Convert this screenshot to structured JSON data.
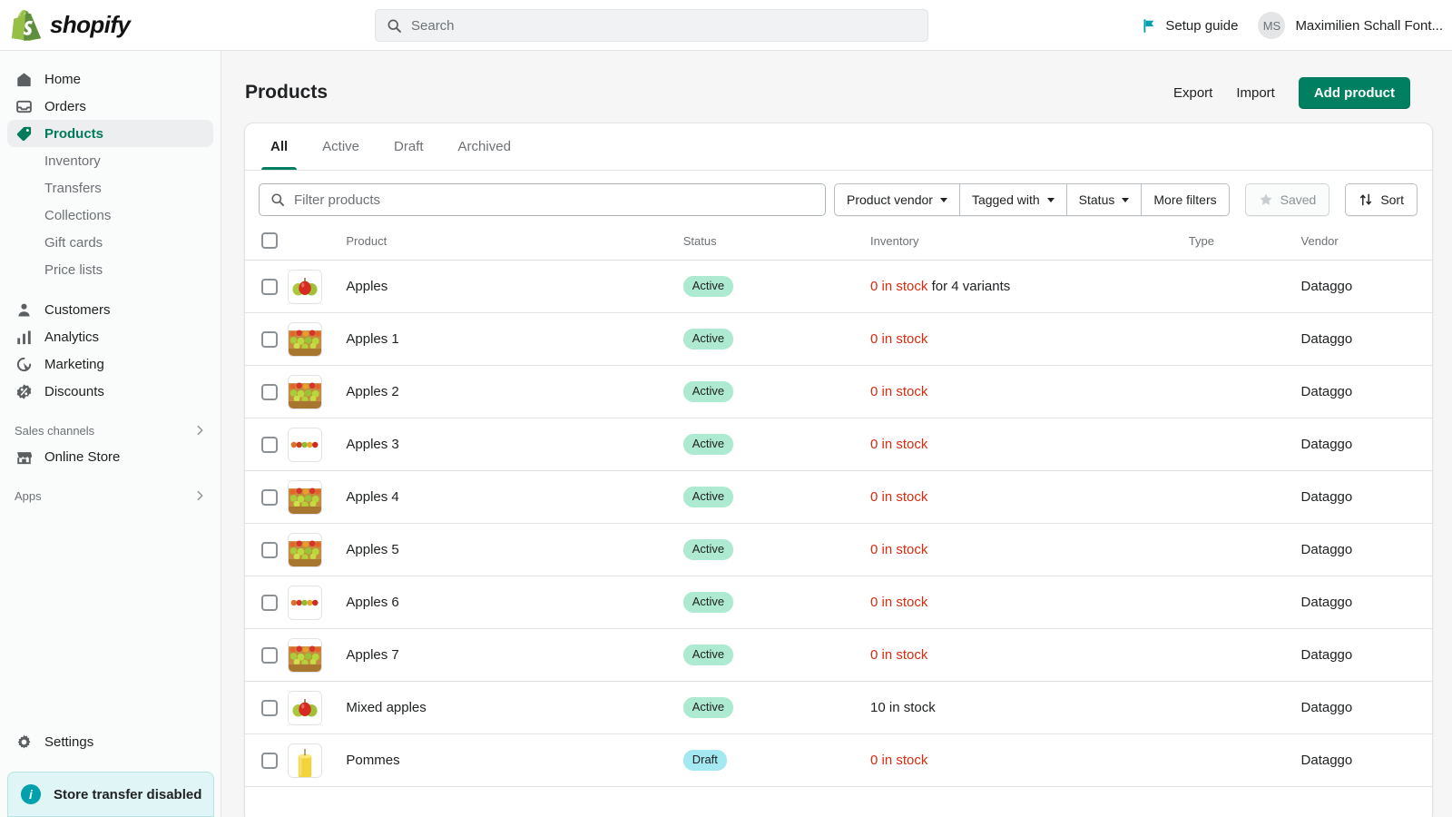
{
  "topbar": {
    "brand_name": "shopify",
    "search_placeholder": "Search",
    "search_value": "",
    "search_icon": "search-icon",
    "setup_guide_label": "Setup guide",
    "setup_guide_icon": "flag-icon",
    "user_initials": "MS",
    "user_name": "Maximilien Schall Font...",
    "accent_teal": "#00a0ac"
  },
  "sidebar": {
    "items": [
      {
        "label": "Home",
        "icon": "home-icon",
        "active": false
      },
      {
        "label": "Orders",
        "icon": "orders-inbox-icon",
        "active": false
      },
      {
        "label": "Products",
        "icon": "product-tag-icon",
        "active": true
      }
    ],
    "sub_items": [
      {
        "label": "Inventory"
      },
      {
        "label": "Transfers"
      },
      {
        "label": "Collections"
      },
      {
        "label": "Gift cards"
      },
      {
        "label": "Price lists"
      }
    ],
    "items2": [
      {
        "label": "Customers",
        "icon": "customer-icon"
      },
      {
        "label": "Analytics",
        "icon": "analytics-bars-icon"
      },
      {
        "label": "Marketing",
        "icon": "marketing-target-icon"
      },
      {
        "label": "Discounts",
        "icon": "discount-badge-icon"
      }
    ],
    "sales_channels_label": "Sales channels",
    "online_store_label": "Online Store",
    "online_store_icon": "storefront-icon",
    "apps_label": "Apps",
    "chevron_icon": "chevron-right-icon",
    "settings_label": "Settings",
    "settings_icon": "gear-icon",
    "banner": {
      "label": "Store transfer disabled",
      "icon": "info-icon",
      "bg": "#e0f5f5"
    }
  },
  "header": {
    "title": "Products",
    "export_label": "Export",
    "import_label": "Import",
    "add_product_label": "Add product",
    "primary_color": "#008060"
  },
  "tabs": [
    {
      "label": "All",
      "active": true
    },
    {
      "label": "Active",
      "active": false
    },
    {
      "label": "Draft",
      "active": false
    },
    {
      "label": "Archived",
      "active": false
    }
  ],
  "filters": {
    "search_placeholder": "Filter products",
    "search_value": "",
    "search_icon": "search-icon",
    "buttons": [
      {
        "label": "Product vendor",
        "caret": true
      },
      {
        "label": "Tagged with",
        "caret": true
      },
      {
        "label": "Status",
        "caret": true
      },
      {
        "label": "More filters",
        "caret": false
      }
    ],
    "saved_label": "Saved",
    "saved_icon": "star-icon",
    "saved_disabled": true,
    "sort_label": "Sort",
    "sort_icon": "sort-arrows-icon"
  },
  "table": {
    "columns": [
      "Product",
      "Status",
      "Inventory",
      "Type",
      "Vendor"
    ],
    "select_all_checkbox": "select-all-checkbox",
    "rows": [
      {
        "name": "Apples",
        "thumb": "apples-trio",
        "status": "Active",
        "status_kind": "active",
        "stock": "0 in stock",
        "stock_zero": true,
        "stock_note": " for 4 variants",
        "type": "",
        "vendor": "Dataggo"
      },
      {
        "name": "Apples 1",
        "thumb": "fruit-market",
        "status": "Active",
        "status_kind": "active",
        "stock": "0 in stock",
        "stock_zero": true,
        "stock_note": "",
        "type": "",
        "vendor": "Dataggo"
      },
      {
        "name": "Apples 2",
        "thumb": "fruit-market",
        "status": "Active",
        "status_kind": "active",
        "stock": "0 in stock",
        "stock_zero": true,
        "stock_note": "",
        "type": "",
        "vendor": "Dataggo"
      },
      {
        "name": "Apples 3",
        "thumb": "apple-row",
        "status": "Active",
        "status_kind": "active",
        "stock": "0 in stock",
        "stock_zero": true,
        "stock_note": "",
        "type": "",
        "vendor": "Dataggo"
      },
      {
        "name": "Apples 4",
        "thumb": "fruit-market",
        "status": "Active",
        "status_kind": "active",
        "stock": "0 in stock",
        "stock_zero": true,
        "stock_note": "",
        "type": "",
        "vendor": "Dataggo"
      },
      {
        "name": "Apples 5",
        "thumb": "fruit-market",
        "status": "Active",
        "status_kind": "active",
        "stock": "0 in stock",
        "stock_zero": true,
        "stock_note": "",
        "type": "",
        "vendor": "Dataggo"
      },
      {
        "name": "Apples 6",
        "thumb": "apple-row",
        "status": "Active",
        "status_kind": "active",
        "stock": "0 in stock",
        "stock_zero": true,
        "stock_note": "",
        "type": "",
        "vendor": "Dataggo"
      },
      {
        "name": "Apples 7",
        "thumb": "fruit-market",
        "status": "Active",
        "status_kind": "active",
        "stock": "0 in stock",
        "stock_zero": true,
        "stock_note": "",
        "type": "",
        "vendor": "Dataggo"
      },
      {
        "name": "Mixed apples",
        "thumb": "apples-trio",
        "status": "Active",
        "status_kind": "active",
        "stock": "10 in stock",
        "stock_zero": false,
        "stock_note": "",
        "type": "",
        "vendor": "Dataggo"
      },
      {
        "name": "Pommes",
        "thumb": "yellow-candle",
        "status": "Draft",
        "status_kind": "draft",
        "stock": "0 in stock",
        "stock_zero": true,
        "stock_note": "",
        "type": "",
        "vendor": "Dataggo"
      }
    ]
  },
  "colors": {
    "stock_red": "#d72c0d",
    "badge_active": "#aee9d1",
    "badge_draft": "#a4e8f2",
    "sidebar_bg": "#fafbfb",
    "page_bg": "#f6f6f7"
  }
}
